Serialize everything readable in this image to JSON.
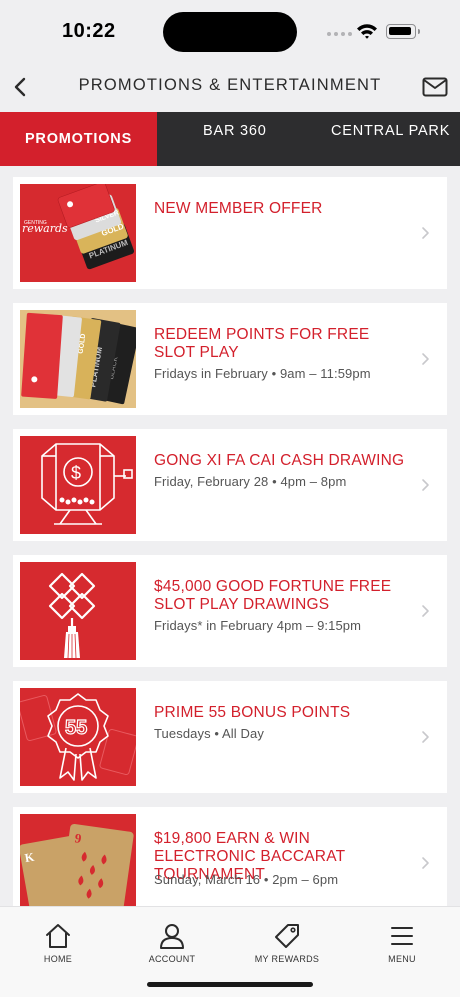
{
  "status_bar": {
    "time": "10:22"
  },
  "header": {
    "title": "PROMOTIONS & ENTERTAINMENT",
    "back_icon": "chevron-left-icon",
    "mail_icon": "envelope-icon"
  },
  "tabs": [
    {
      "label": "PROMOTIONS",
      "active": true
    },
    {
      "label": "BAR 360",
      "active": false
    },
    {
      "label": "CENTRAL PARK",
      "active": false
    }
  ],
  "promotions": [
    {
      "title": "NEW MEMBER OFFER",
      "subtitle": "",
      "image": "rewards-cards"
    },
    {
      "title": "REDEEM POINTS FOR FREE SLOT PLAY",
      "subtitle": "Fridays in February • 9am – 11:59pm",
      "image": "tier-cards"
    },
    {
      "title": "GONG XI FA CAI CASH DRAWING",
      "subtitle": "Friday, February 28 • 4pm – 8pm",
      "image": "drawing-drum"
    },
    {
      "title": "$45,000 GOOD FORTUNE FREE SLOT PLAY DRAWINGS",
      "subtitle": "Fridays* in February 4pm – 9:15pm",
      "image": "chinese-knot"
    },
    {
      "title": "PRIME 55 BONUS POINTS",
      "subtitle": "Tuesdays • All Day",
      "image": "ribbon-55"
    },
    {
      "title": "$19,800 EARN & WIN ELECTRONIC BACCARAT TOURNAMENT",
      "subtitle": "Sunday, March 16 • 2pm – 6pm",
      "image": "playing-cards"
    }
  ],
  "bottom_nav": [
    {
      "label": "HOME",
      "icon": "home-icon"
    },
    {
      "label": "ACCOUNT",
      "icon": "person-icon"
    },
    {
      "label": "MY REWARDS",
      "icon": "tag-icon"
    },
    {
      "label": "MENU",
      "icon": "hamburger-icon"
    }
  ],
  "colors": {
    "brand_red": "#d3202c",
    "tab_bar_dark": "#2d2d2f",
    "background": "#efeff1"
  }
}
